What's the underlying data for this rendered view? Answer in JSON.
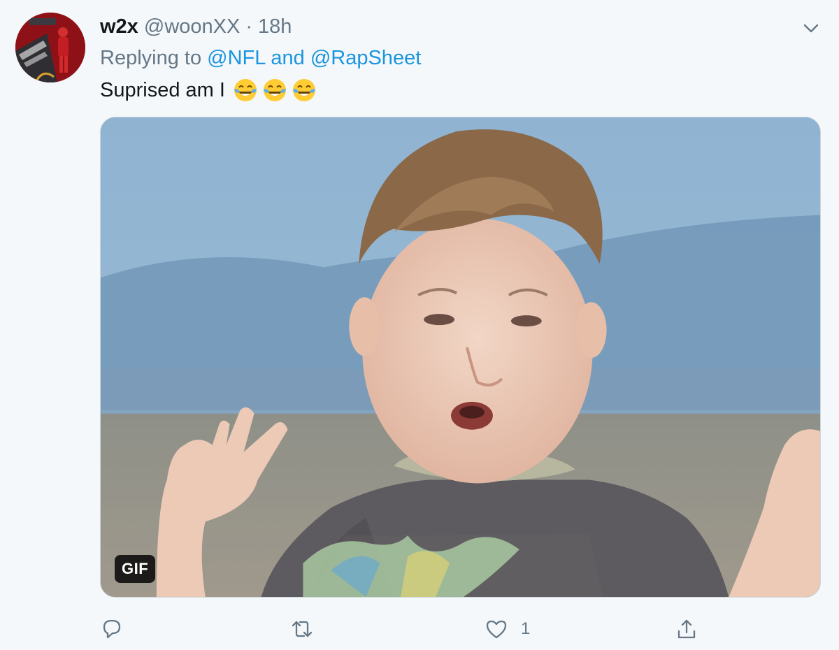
{
  "tweet": {
    "display_name": "w2x",
    "handle": "@woonXX",
    "separator": "·",
    "time": "18h",
    "reply_prefix": "Replying to",
    "reply_mention_1": "@NFL",
    "reply_and": "and",
    "reply_mention_2": "@RapSheet",
    "text": "Suprised am I",
    "emojis": [
      "face-with-tears-of-joy-icon",
      "face-with-tears-of-joy-icon",
      "face-with-tears-of-joy-icon"
    ]
  },
  "media": {
    "badge": "GIF"
  },
  "actions": {
    "reply_count": "",
    "retweet_count": "",
    "like_count": "1",
    "share_count": ""
  },
  "colors": {
    "link": "#1b95e0",
    "muted": "#657786",
    "background": "#f5f8fa"
  }
}
